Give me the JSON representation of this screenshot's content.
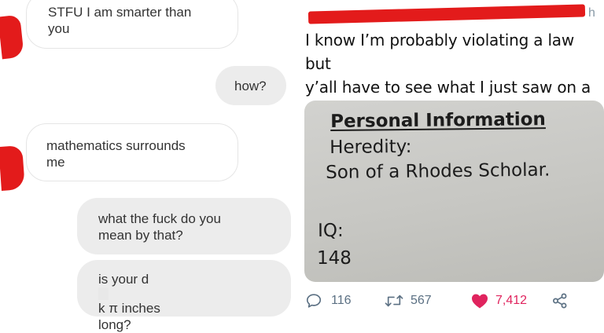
{
  "chat": {
    "messages": [
      {
        "side": "received",
        "text": "STFU I am smarter than\nyou"
      },
      {
        "side": "sent",
        "text": "how?"
      },
      {
        "side": "received",
        "text": "mathematics surrounds\nme"
      },
      {
        "side": "sent",
        "text": "what the fuck do you\nmean by that?"
      },
      {
        "side": "sent",
        "text_before": "is your d",
        "text_after": "k π inches",
        "text_line2": "long?"
      }
    ]
  },
  "tweet": {
    "header_fragment": "h",
    "text": "I know I’m probably violating a law but\ny’all have to see what I just saw on a\nresume",
    "photo": {
      "heading": "Personal Information",
      "line1": "Heredity:",
      "line2": "Son of a Rhodes Scholar.",
      "line3": "IQ:",
      "line4": "148"
    },
    "actions": {
      "reply_count": "116",
      "retweet_count": "567",
      "like_count": "7,412"
    },
    "colors": {
      "like": "#e0245e",
      "action_gray": "#5b7083",
      "redaction": "#e31b1b"
    },
    "icons": [
      "reply-icon",
      "retweet-icon",
      "heart-icon",
      "share-icon"
    ]
  }
}
